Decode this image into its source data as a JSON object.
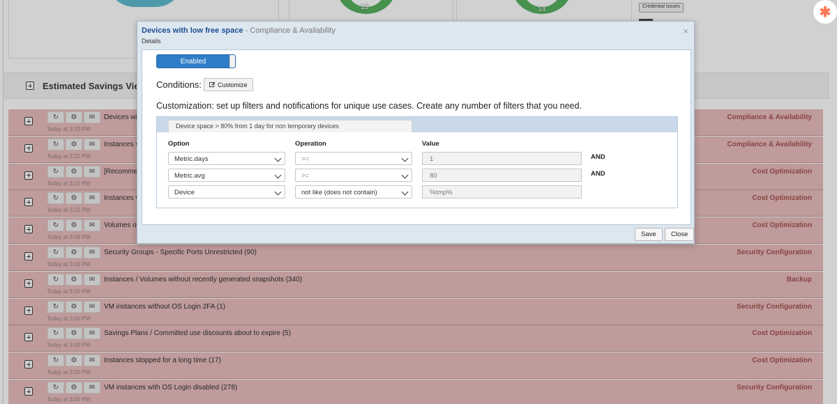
{
  "background": {
    "donuts": [
      {
        "label": "13",
        "color": "#3fa84a"
      },
      {
        "label": "14",
        "color": "#3fa84a"
      }
    ],
    "credential_badge": "Credential issues",
    "panel_title": "Estimated Savings View",
    "rows": [
      {
        "title": "Devices wi",
        "time": "Today at 3:23 PM",
        "category": "Compliance & Availability"
      },
      {
        "title": "Instances w",
        "time": "Today at 3:22 PM",
        "category": "Compliance & Availability"
      },
      {
        "title": "[Recomme",
        "time": "Today at 3:15 PM",
        "category": "Cost Optimization"
      },
      {
        "title": "Instances w",
        "time": "Today at 3:15 PM",
        "category": "Cost Optimization"
      },
      {
        "title": "Volumes o",
        "time": "Today at 3:08 PM",
        "category": "Cost Optimization"
      },
      {
        "title": "Security Groups - Specific Ports Unrestricted (90)",
        "time": "Today at 3:00 PM",
        "category": "Security Configuration"
      },
      {
        "title": "Instances / Volumes without recently generated snapshots (340)",
        "time": "Today at 3:00 PM",
        "category": "Backup"
      },
      {
        "title": "VM instances without OS Login 2FA (1)",
        "time": "Today at 3:00 PM",
        "category": "Security Configuration"
      },
      {
        "title": "Savings Plans / Committed use discounts about to expire (5)",
        "time": "Today at 3:00 PM",
        "category": "Cost Optimization"
      },
      {
        "title": "Instances stopped for a long time (17)",
        "time": "Today at 3:00 PM",
        "category": "Cost Optimization"
      },
      {
        "title": "VM instances with OS Login disabled (278)",
        "time": "Today at 3:00 PM",
        "category": "Security Configuration"
      }
    ]
  },
  "modal": {
    "title": "Devices with low free space",
    "title_suffix": " - Compliance & Availability",
    "subtitle": "Details",
    "close_glyph": "×",
    "toggle_label": "Enabled",
    "conditions_label": "Conditions:",
    "customize_label": "Customize",
    "customization_text": "Customization: set up filters and notifications for unique use cases. Create any number of filters that you need.",
    "filter_tab": "Device space > 80% from 1 day for non temporary devices",
    "columns": {
      "option": "Option",
      "operation": "Operation",
      "value": "Value"
    },
    "filters": [
      {
        "option": "Metric.days",
        "operation": ">=",
        "value": "1",
        "joiner": "AND"
      },
      {
        "option": "Metric.avg",
        "operation": ">=",
        "value": "80",
        "joiner": "AND"
      },
      {
        "option": "Device",
        "operation": "not like (does not contain)",
        "value": "%tmp%",
        "joiner": ""
      }
    ],
    "save_label": "Save",
    "close_label": "Close"
  },
  "colors": {
    "row_bg": "#e6b5b5",
    "category_text": "#9a3a3a",
    "title_blue": "#1d4f91",
    "toggle_blue": "#2f7dc8",
    "hubspot_orange": "#ff7a59"
  }
}
